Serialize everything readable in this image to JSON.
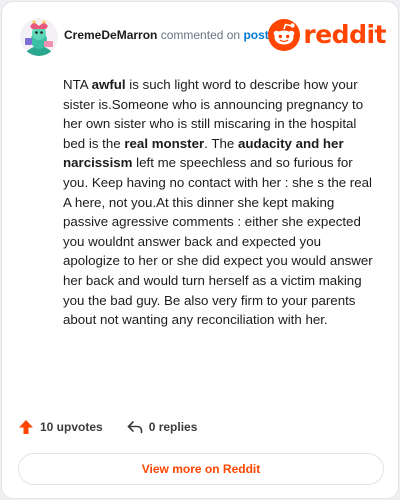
{
  "comment": {
    "username": "CremeDeMarron",
    "action_text": "commented on",
    "link_text": "post",
    "body": [
      {
        "text": "NTA ",
        "bold": false
      },
      {
        "text": "awful",
        "bold": true
      },
      {
        "text": " is such light word to describe how your sister is.Someone who is announcing pregnancy to her own sister who is still miscaring in the hospital bed is the ",
        "bold": false
      },
      {
        "text": "real monster",
        "bold": true
      },
      {
        "text": ". The ",
        "bold": false
      },
      {
        "text": "audacity and her narcissism",
        "bold": true
      },
      {
        "text": " left me speechless and so furious for you. Keep having no contact with her : she s the real A here, not you.At this dinner she kept making passive agressive comments : either she expected you wouldnt answer back and expected you apologize to her or she did expect you would answer her back and would turn herself as a victim making you the bad guy. Be also very firm to your parents about not wanting any reconciliation with her.",
        "bold": false
      }
    ]
  },
  "brand": {
    "logo_text": "reddit",
    "accent_color": "#ff4500",
    "link_color": "#0079d3"
  },
  "stats": {
    "upvotes_label": "10 upvotes",
    "replies_label": "0 replies",
    "upvote_icon": "upvote-arrow-icon",
    "reply_icon": "reply-arrow-icon"
  },
  "footer": {
    "view_more_label": "View more on Reddit"
  }
}
